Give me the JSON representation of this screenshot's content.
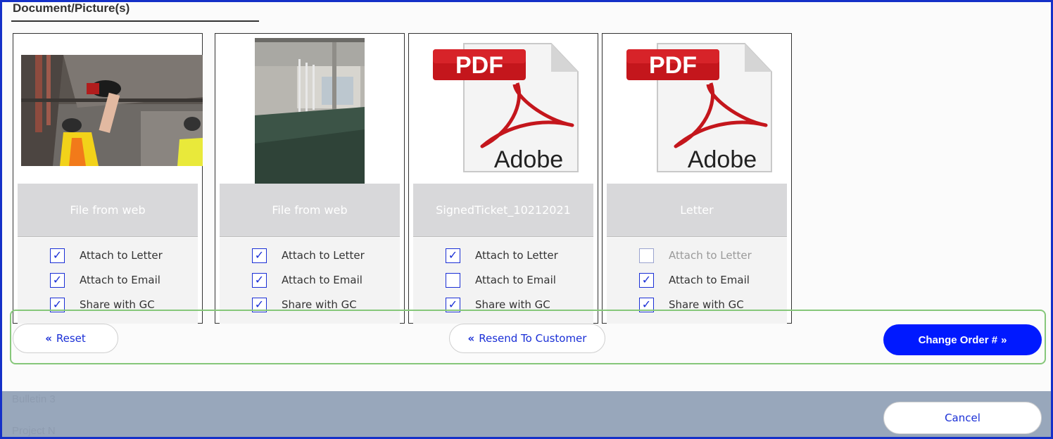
{
  "section": {
    "title": "Document/Picture(s)"
  },
  "cards": [
    {
      "caption": "File from web",
      "thumb": "photo-workers-drilling-ceiling",
      "checks": [
        {
          "label": "Attach to Letter",
          "checked": true,
          "disabled": false
        },
        {
          "label": "Attach to Email",
          "checked": true,
          "disabled": false
        },
        {
          "label": "Share with GC",
          "checked": true,
          "disabled": false
        }
      ]
    },
    {
      "caption": "File from web",
      "thumb": "photo-empty-warehouse-interior",
      "checks": [
        {
          "label": "Attach to Letter",
          "checked": true,
          "disabled": false
        },
        {
          "label": "Attach to Email",
          "checked": true,
          "disabled": false
        },
        {
          "label": "Share with GC",
          "checked": true,
          "disabled": false
        }
      ]
    },
    {
      "caption": "SignedTicket_10212021",
      "thumb": "pdf-file-icon",
      "pdf_label": "PDF",
      "pdf_brand": "Adobe",
      "checks": [
        {
          "label": "Attach to Letter",
          "checked": true,
          "disabled": false
        },
        {
          "label": "Attach to Email",
          "checked": false,
          "disabled": false
        },
        {
          "label": "Share with GC",
          "checked": true,
          "disabled": false
        }
      ]
    },
    {
      "caption": "Letter",
      "thumb": "pdf-file-icon",
      "pdf_label": "PDF",
      "pdf_brand": "Adobe",
      "checks": [
        {
          "label": "Attach to Letter",
          "checked": false,
          "disabled": true
        },
        {
          "label": "Attach to Email",
          "checked": true,
          "disabled": false
        },
        {
          "label": "Share with GC",
          "checked": true,
          "disabled": false
        }
      ]
    }
  ],
  "actions": {
    "reset_label": "Reset",
    "resend_label": "Resend To Customer",
    "change_order_label": "Change Order #",
    "cancel_label": "Cancel"
  },
  "background": {
    "ghost_line_1": "Bulletin 3",
    "ghost_line_2": "Project N"
  },
  "colors": {
    "accent": "#0019ff",
    "link": "#1a2fd6",
    "highlight": "#86c77a",
    "frame": "#1530c8",
    "caption_bg": "#d8d8da"
  }
}
